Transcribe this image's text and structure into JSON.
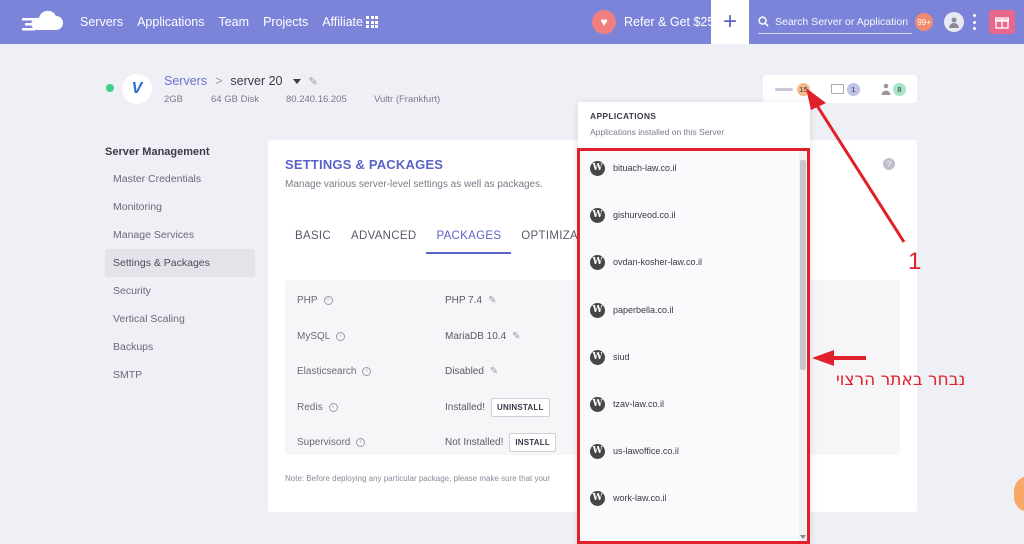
{
  "nav": {
    "items": [
      "Servers",
      "Applications",
      "Team",
      "Projects",
      "Affiliate"
    ],
    "refer_label": "Refer & Get $25",
    "plus_label": "+",
    "search_placeholder": "Search Server or Application",
    "notifications_count": "99+"
  },
  "server": {
    "breadcrumb_root": "Servers",
    "separator": ">",
    "name": "server 20",
    "ram": "2GB",
    "disk": "64 GB Disk",
    "ip": "80.240.16.205",
    "provider": "Vultr (Frankfurt)",
    "status": "online"
  },
  "pills": {
    "apps_count": "15",
    "mail_count": "1",
    "users_count": "8"
  },
  "sidebar": {
    "title": "Server Management",
    "items": [
      {
        "label": "Master Credentials"
      },
      {
        "label": "Monitoring"
      },
      {
        "label": "Manage Services"
      },
      {
        "label": "Settings & Packages",
        "active": true
      },
      {
        "label": "Security"
      },
      {
        "label": "Vertical Scaling"
      },
      {
        "label": "Backups"
      },
      {
        "label": "SMTP"
      }
    ]
  },
  "card": {
    "title": "SETTINGS & PACKAGES",
    "subtitle": "Manage various server-level settings as well as packages.",
    "help": "?",
    "tabs": [
      {
        "label": "BASIC"
      },
      {
        "label": "ADVANCED"
      },
      {
        "label": "PACKAGES",
        "active": true
      },
      {
        "label": "OPTIMIZATIO"
      }
    ],
    "packages": [
      {
        "name": "PHP",
        "value": "PHP 7.4",
        "action": "edit"
      },
      {
        "name": "MySQL",
        "value": "MariaDB 10.4",
        "action": "edit"
      },
      {
        "name": "Elasticsearch",
        "value": "Disabled",
        "action": "edit"
      },
      {
        "name": "Redis",
        "value": "Installed!",
        "button": "UNINSTALL"
      },
      {
        "name": "Supervisord",
        "value": "Not Installed!",
        "button": "INSTALL"
      }
    ],
    "note": "Note: Before deploying any particular package, please make sure that your"
  },
  "apps": {
    "title": "APPLICATIONS",
    "subtitle": "Applications installed on this Server",
    "items": [
      "bituach-law.co.il",
      "gishurveod.co.il",
      "ovdan-kosher-law.co.il",
      "paperbella.co.il",
      "siud",
      "tzav-law.co.il",
      "us-lawoffice.co.il",
      "work-law.co.il"
    ]
  },
  "annotations": {
    "number": "1",
    "hebrew_text": "נבחר באתר הרצוי",
    "color": "#e0202a"
  },
  "colors": {
    "nav_bg": "#7b84d8",
    "accent": "#5a63c8",
    "status_online": "#3fd08a"
  }
}
